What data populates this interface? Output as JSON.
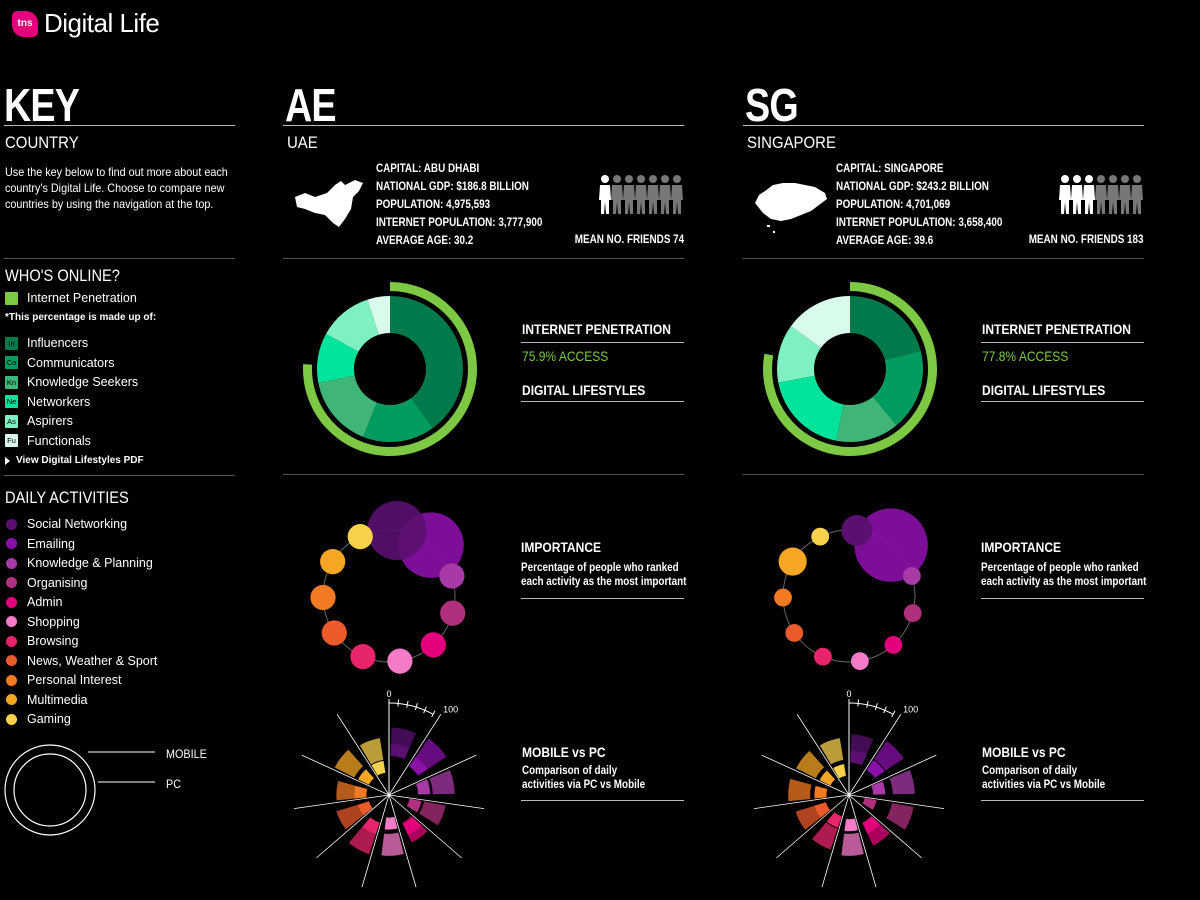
{
  "brand": {
    "logo": "tns",
    "title": "Digital Life"
  },
  "key": {
    "title": "KEY",
    "country_heading": "COUNTRY",
    "intro": [
      "Use the key below to find out more about each",
      "country's Digital Life. Choose to compare new",
      "countries by using the navigation at the top."
    ],
    "whos_online": {
      "heading": "WHO'S ONLINE?",
      "penetration_label": "Internet Penetration",
      "note": "*This percentage is made up of:",
      "segments": [
        {
          "abbr": "In",
          "label": "Influencers",
          "color": "#007a4a"
        },
        {
          "abbr": "Co",
          "label": "Communicators",
          "color": "#009c5f"
        },
        {
          "abbr": "Kn",
          "label": "Knowledge Seekers",
          "color": "#3fb577"
        },
        {
          "abbr": "Ne",
          "label": "Networkers",
          "color": "#00e39a"
        },
        {
          "abbr": "As",
          "label": "Aspirers",
          "color": "#7ff0c2"
        },
        {
          "abbr": "Fu",
          "label": "Functionals",
          "color": "#d8fbec"
        }
      ],
      "pdf_link": "View Digital Lifestyles PDF"
    },
    "daily_activities": {
      "heading": "DAILY ACTIVITIES",
      "items": [
        {
          "label": "Social Networking",
          "color": "#5a1070"
        },
        {
          "label": "Emailing",
          "color": "#8a10a8"
        },
        {
          "label": "Knowledge & Planning",
          "color": "#a83aa8"
        },
        {
          "label": "Organising",
          "color": "#b0307e"
        },
        {
          "label": "Admin",
          "color": "#e4007c"
        },
        {
          "label": "Shopping",
          "color": "#f57ac8"
        },
        {
          "label": "Browsing",
          "color": "#e8246c"
        },
        {
          "label": "News, Weather & Sport",
          "color": "#ea5a2a"
        },
        {
          "label": "Personal Interest",
          "color": "#f27a22"
        },
        {
          "label": "Multimedia",
          "color": "#f5a623"
        },
        {
          "label": "Gaming",
          "color": "#f8d24a"
        }
      ]
    },
    "ring_legend": {
      "mobile": "MOBILE",
      "pc": "PC"
    }
  },
  "countries": [
    {
      "code": "AE",
      "name": "UAE",
      "stats": [
        "CAPITAL: ABU DHABI",
        "NATIONAL GDP: $186.8 BILLION",
        "POPULATION: 4,975,593",
        "INTERNET POPULATION: 3,777,900",
        "AVERAGE AGE: 30.2"
      ],
      "mean_friends": "MEAN NO. FRIENDS 74",
      "friends_highlight": 1,
      "penetration_title": "INTERNET PENETRATION",
      "access": "75.9% ACCESS",
      "penetration_value": 75.9,
      "lifestyles_title": "DIGITAL LIFESTYLES",
      "lifestyle_shares": [
        0.4,
        0.16,
        0.16,
        0.11,
        0.12,
        0.05
      ],
      "importance_title": "IMPORTANCE",
      "importance_desc": [
        "Percentage of people who ranked",
        "each activity as the most important"
      ],
      "importance": [
        22,
        27,
        4,
        4,
        4,
        4,
        4,
        4,
        4,
        4,
        4
      ],
      "mobile_pc_title": "MOBILE vs PC",
      "mobile_pc_desc": [
        "Comparison of daily",
        "activities via PC vs Mobile"
      ],
      "pc": [
        70,
        72,
        68,
        58,
        52,
        62,
        64,
        55,
        52,
        62,
        58
      ],
      "mobile": [
        50,
        45,
        38,
        28,
        42,
        30,
        38,
        28,
        30,
        30,
        30
      ],
      "scale_min": "0",
      "scale_max": "100"
    },
    {
      "code": "SG",
      "name": "SINGAPORE",
      "stats": [
        "CAPITAL: SINGAPORE",
        "NATIONAL GDP: $243.2 BILLION",
        "POPULATION: 4,701,069",
        "INTERNET POPULATION: 3,658,400",
        "AVERAGE AGE: 39.6"
      ],
      "mean_friends": "MEAN NO. FRIENDS 183",
      "friends_highlight": 3,
      "penetration_title": "INTERNET PENETRATION",
      "access": "77.8% ACCESS",
      "penetration_value": 77.8,
      "lifestyles_title": "DIGITAL LIFESTYLES",
      "lifestyle_shares": [
        0.21,
        0.18,
        0.14,
        0.19,
        0.13,
        0.15
      ],
      "importance_title": "IMPORTANCE",
      "importance_desc": [
        "Percentage of people who ranked",
        "each activity as the most important"
      ],
      "importance": [
        6,
        34,
        2,
        2,
        2,
        2,
        2,
        2,
        2,
        5,
        2
      ],
      "mobile_pc_title": "MOBILE vs PC",
      "mobile_pc_desc": [
        "Comparison of daily",
        "activities via PC vs Mobile"
      ],
      "pc": [
        62,
        68,
        68,
        68,
        56,
        62,
        58,
        56,
        62,
        60,
        58
      ],
      "mobile": [
        42,
        40,
        32,
        22,
        40,
        32,
        30,
        32,
        30,
        28,
        26
      ],
      "scale_min": "0",
      "scale_max": "100"
    }
  ]
}
